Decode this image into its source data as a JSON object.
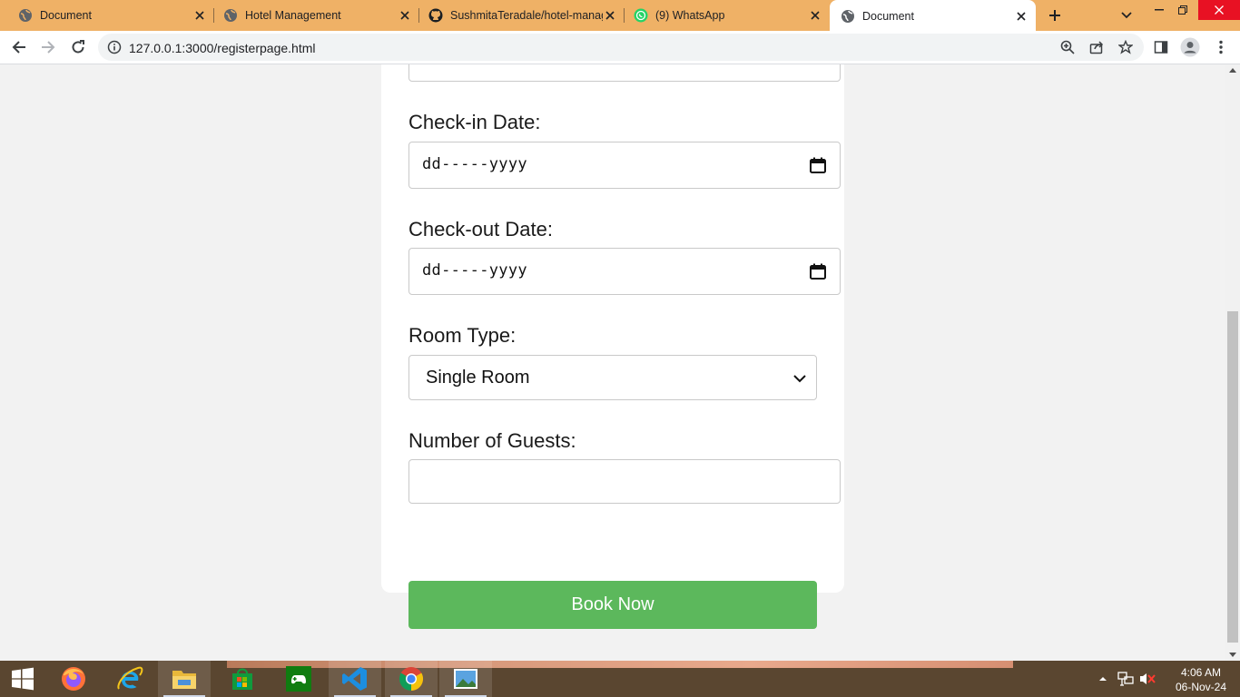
{
  "browser": {
    "tabs": [
      {
        "title": "Document",
        "favicon": "globe-icon",
        "active": false
      },
      {
        "title": "Hotel Management",
        "favicon": "globe-icon",
        "active": false
      },
      {
        "title": "SushmitaTeradale/hotel-manag",
        "favicon": "github-icon",
        "active": false
      },
      {
        "title": "(9) WhatsApp",
        "favicon": "whatsapp-icon",
        "active": false
      },
      {
        "title": "Document",
        "favicon": "globe-icon",
        "active": true
      }
    ],
    "url": "127.0.0.1:3000/registerpage.html",
    "tabstrip_color": "#efb166"
  },
  "form": {
    "checkin_label": "Check-in Date:",
    "checkin_placeholder": "dd-----yyyy",
    "checkout_label": "Check-out Date:",
    "checkout_placeholder": "dd-----yyyy",
    "room_type_label": "Room Type:",
    "room_type_selected": "Single Room",
    "guests_label": "Number of Guests:",
    "guests_value": "",
    "submit_label": "Book Now",
    "submit_color": "#5cb85c"
  },
  "taskbar": {
    "time": "4:06 AM",
    "date": "06-Nov-24",
    "apps": [
      "windows-start-icon",
      "firefox-icon",
      "internet-explorer-icon",
      "file-explorer-icon",
      "microsoft-store-icon",
      "xbox-icon",
      "vscode-icon",
      "chrome-icon",
      "photos-icon"
    ]
  }
}
